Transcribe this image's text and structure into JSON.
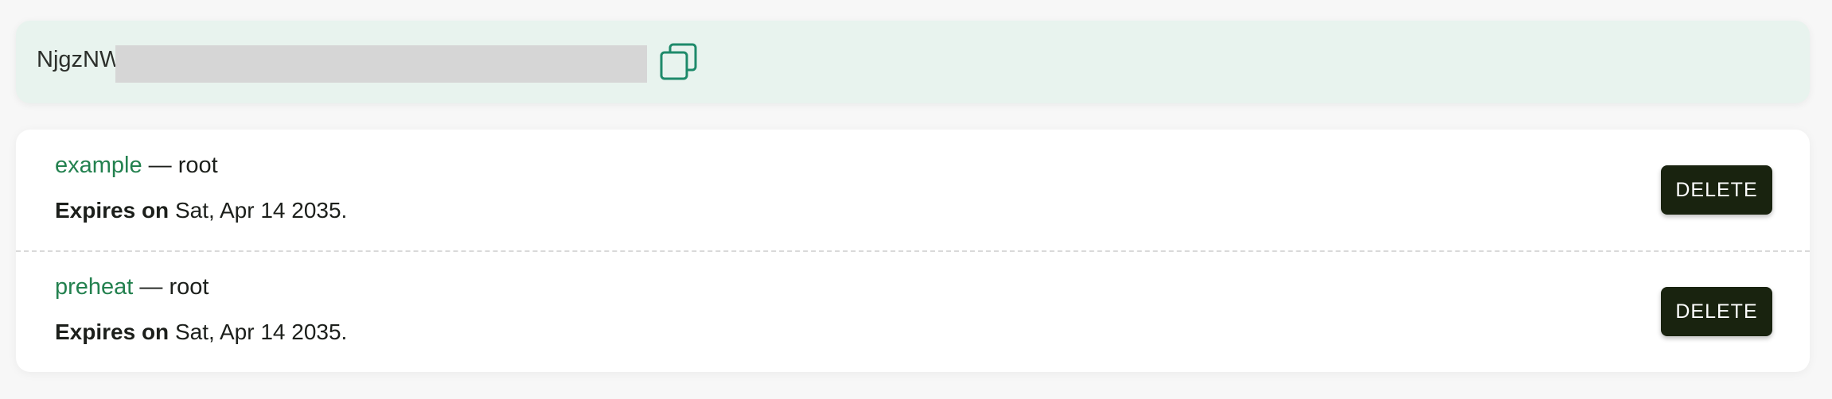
{
  "token": {
    "prefix": "NjgzNW",
    "copy_icon": "copy-icon",
    "accent_color": "#1e8a6a"
  },
  "keys": [
    {
      "name": "example",
      "separator": " — ",
      "user": "root",
      "expires_label": "Expires on",
      "expires_value": " Sat, Apr 14 2035.",
      "delete_label": "DELETE"
    },
    {
      "name": "preheat",
      "separator": " — ",
      "user": "root",
      "expires_label": "Expires on",
      "expires_value": " Sat, Apr 14 2035.",
      "delete_label": "DELETE"
    }
  ],
  "colors": {
    "name_green": "#23814f",
    "delete_bg": "#19230f",
    "panel_bg": "#e8f3ee"
  }
}
